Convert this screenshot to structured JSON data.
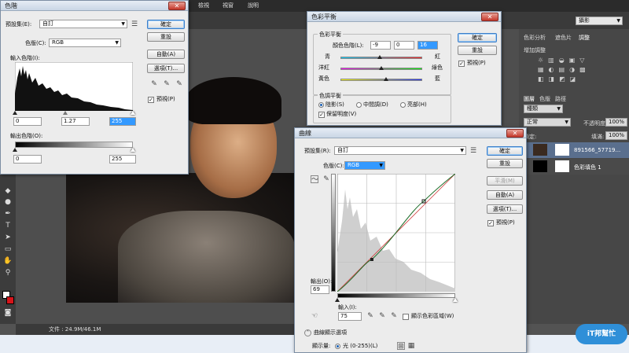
{
  "menubar": {
    "items": [
      "檢視",
      "視窗",
      "說明"
    ],
    "workspace": "攝影"
  },
  "statusbar": {
    "doc": "文件 : 24.9M/46.1M"
  },
  "levels": {
    "title": "色階",
    "preset_label": "預設集(E):",
    "preset_value": "自訂",
    "channel_label": "色版(C):",
    "channel_value": "RGB",
    "input_label": "輸入色階(I):",
    "input_values": [
      "0",
      "1.27",
      "255"
    ],
    "output_label": "輸出色階(O):",
    "output_values": [
      "0",
      "255"
    ],
    "ok": "確定",
    "reset": "重設",
    "auto": "自動(A)",
    "options": "選項(T)...",
    "preview": "預視(P)"
  },
  "color_balance": {
    "title": "色彩平衡",
    "group1": "色彩平衡",
    "levels_label": "顏色色階(L):",
    "levels_values": [
      "-9",
      "0",
      "16"
    ],
    "sliders": [
      {
        "left": "青",
        "right": "紅"
      },
      {
        "left": "洋紅",
        "right": "綠色"
      },
      {
        "left": "黃色",
        "right": "藍"
      }
    ],
    "group2": "色調平衡",
    "tones": [
      "陰影(S)",
      "中間調(D)",
      "亮部(H)"
    ],
    "preserve": "保留明度(V)",
    "ok": "確定",
    "reset": "重設",
    "preview": "預視(P)"
  },
  "curves": {
    "title": "曲線",
    "preset_label": "預設集(R):",
    "preset_value": "自訂",
    "channel_label": "色版(C):",
    "channel_value": "RGB",
    "output_label": "輸出(O):",
    "output_value": "69",
    "input_label": "輸入(I):",
    "input_value": "75",
    "clipping": "顯示色彩區域(W)",
    "options_header": "曲線顯示選項",
    "show_amount": "顯示量:",
    "light_option": "光 (0-255)(L)",
    "ok": "確定",
    "reset": "重設",
    "smooth": "平滑(M)",
    "auto": "自動(A)",
    "options": "選項(T)...",
    "preview": "預視(P)"
  },
  "panels": {
    "adj_tabs": [
      "色彩分析",
      "遮色片",
      "調整"
    ],
    "adj_title": "增加調整",
    "layer_tabs": [
      "圖層",
      "色版",
      "路徑"
    ],
    "blend_kind": "種類",
    "blend_mode": "正常",
    "opacity_label": "不透明度:",
    "opacity": "100%",
    "lock_label": "鎖定:",
    "fill_label": "填滿:",
    "fill": "100%",
    "layers": [
      {
        "name": "891566_57719..."
      },
      {
        "name": "色彩填色 1"
      }
    ]
  },
  "logo": {
    "text": "iT邦幫忙"
  },
  "colors": {
    "accent": "#3399ff",
    "foreground": "#ffffff",
    "background": "#d7141a"
  }
}
